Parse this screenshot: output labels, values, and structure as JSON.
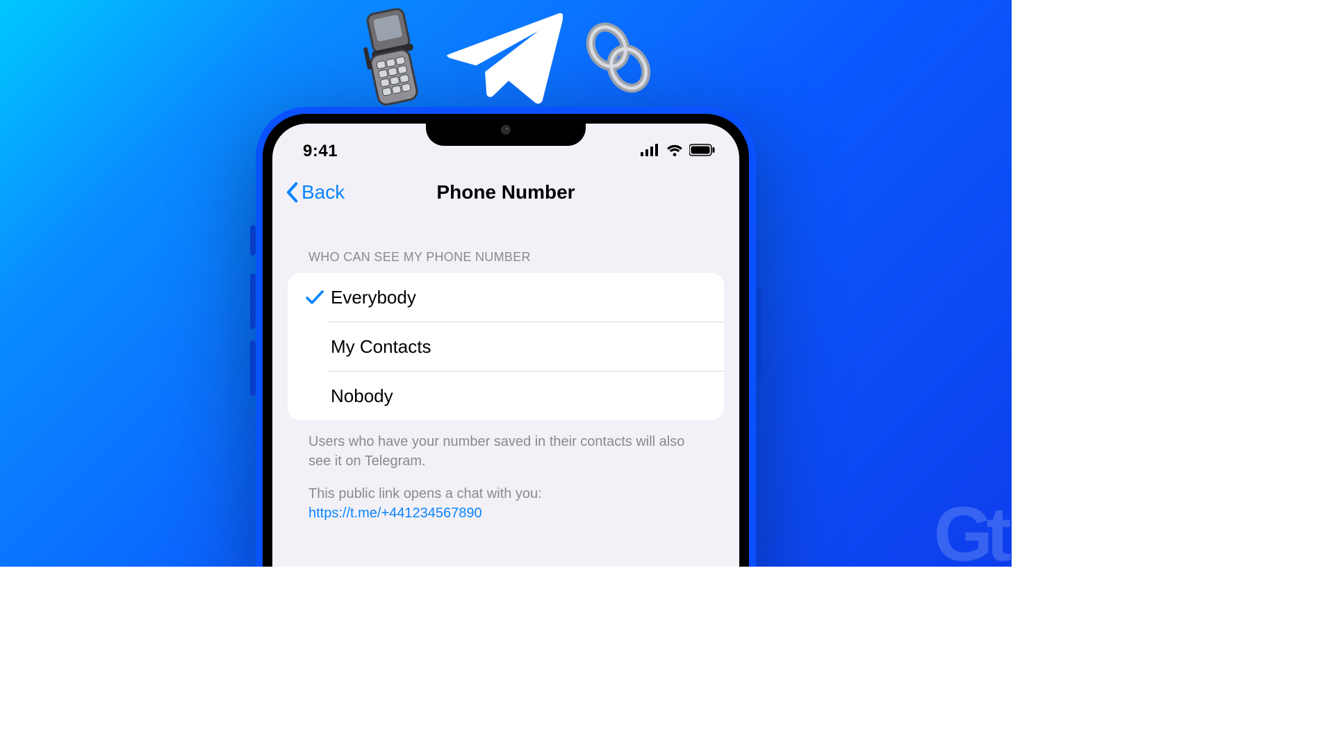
{
  "statusbar": {
    "time": "9:41"
  },
  "nav": {
    "back": "Back",
    "title": "Phone Number"
  },
  "section": {
    "header": "WHO CAN SEE MY PHONE NUMBER",
    "options": [
      {
        "label": "Everybody",
        "selected": true
      },
      {
        "label": "My Contacts",
        "selected": false
      },
      {
        "label": "Nobody",
        "selected": false
      }
    ],
    "footer_line1": "Users who have your number saved in their contacts will also see it on Telegram.",
    "footer_line2": "This public link opens a chat with you:",
    "footer_link": "https://t.me/+441234567890"
  },
  "watermark": "Gt"
}
